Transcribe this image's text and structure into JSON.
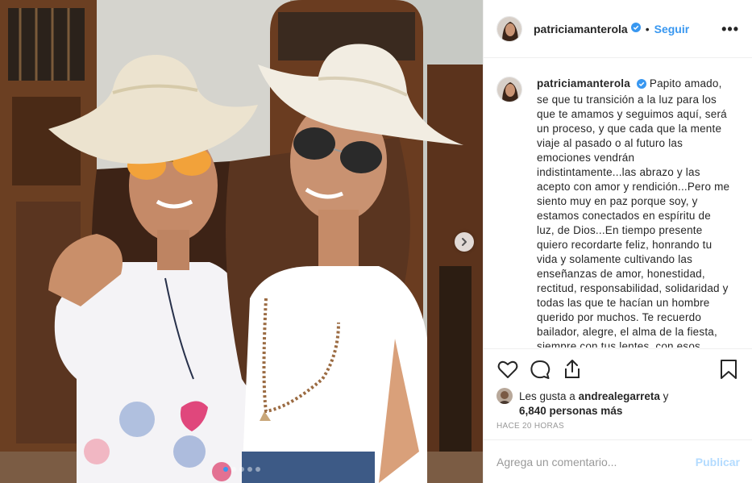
{
  "post": {
    "carousel": {
      "slide_count": 5,
      "active_slide": 1
    }
  },
  "header": {
    "username": "patriciamanterola",
    "separator": "•",
    "follow_label": "Seguir",
    "more_label": "•••"
  },
  "caption": {
    "username": "patriciamanterola",
    "text": "Papito amado, se que tu transición a la luz para los que te amamos y seguimos aquí, será un proceso, y que cada que la mente viaje al pasado o al futuro las emociones vendrán indistintamente...las abrazo y las acepto con amor y rendición...Pero me siento muy en paz porque soy, y estamos conectados en espíritu de luz, de Dios...En tiempo presente quiero recordarte feliz, honrando tu vida y solamente cultivando las enseñanzas de amor, honestidad, rectitud, responsabilidad, solidaridad y todas las que te hacían un hombre querido por muchos. Te recuerdo bailador, alegre, el alma de la fiesta, siempre con tus lentes, con esos sombreros vaqueros que tanto te gustaban ❤️ Michelita"
  },
  "likes": {
    "prefix": "Les gusta a",
    "liker": "andrealegarreta",
    "conjunction": "y",
    "others": "6,840 personas más"
  },
  "timestamp": "HACE 20 HORAS",
  "comment": {
    "placeholder": "Agrega un comentario...",
    "publish_label": "Publicar"
  },
  "colors": {
    "accent": "#3897f0",
    "publish_disabled": "#b3dbff",
    "text": "#262626",
    "muted": "#999999",
    "border": "#efefef"
  },
  "icons": {
    "verified": "verified-badge-icon",
    "like": "heart-icon",
    "comment": "comment-bubble-icon",
    "share": "share-icon",
    "save": "bookmark-icon",
    "next": "chevron-right-icon"
  }
}
